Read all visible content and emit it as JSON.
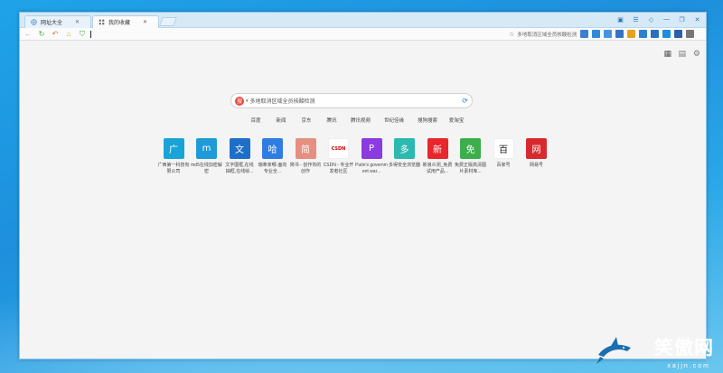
{
  "tabs": [
    {
      "label": "网址大全",
      "active": false
    },
    {
      "label": "我的收藏",
      "active": true
    }
  ],
  "nav": {
    "address_value": "",
    "search_placeholder": "多地取消区域全员核酸检测"
  },
  "search": {
    "placeholder": "多地取消区域全员核酸检测",
    "engines": [
      "百度",
      "新闻",
      "京东",
      "腾讯",
      "腾讯视频",
      "世纪佳缘",
      "搜狗搜索",
      "爱淘宝"
    ]
  },
  "sites": [
    {
      "glyph": "广",
      "color": "#1aa3d6",
      "label": "广西第一科技有限公司"
    },
    {
      "glyph": "m",
      "color": "#1e9bd7",
      "label": "md5在线加密解密"
    },
    {
      "glyph": "文",
      "color": "#1e6fc9",
      "label": "文字图框,在线抽框,在线绘..."
    },
    {
      "glyph": "哈",
      "color": "#2e7de2",
      "label": "瑞奉家哪-面向专业全..."
    },
    {
      "glyph": "简",
      "color": "#e68e7f",
      "label": "简书 - 创作你的创作"
    },
    {
      "glyph": "CSDN",
      "color": "#ffffff",
      "label": "CSDN - 专业开发者社区"
    },
    {
      "glyph": "P",
      "color": "#8b3be0",
      "label": "Putin's government war..."
    },
    {
      "glyph": "多",
      "color": "#2bb9b0",
      "label": "多得安全浏览器"
    },
    {
      "glyph": "新",
      "color": "#e8262b",
      "label": "新浪众测_免费试用产品..."
    },
    {
      "glyph": "免",
      "color": "#3cae4c",
      "label": "免费正版高清图片素材库..."
    },
    {
      "glyph": "百",
      "color": "#ffffff",
      "label": "百家号"
    },
    {
      "glyph": "网",
      "color": "#d8292f",
      "label": "网易号"
    }
  ],
  "watermark": {
    "brand": "笑傲网",
    "url": "xajjn.com"
  }
}
